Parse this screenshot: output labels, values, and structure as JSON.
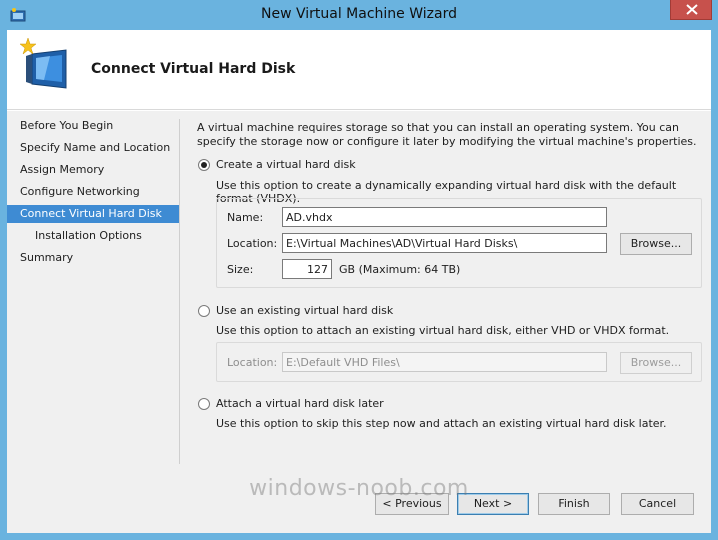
{
  "window": {
    "title": "New Virtual Machine Wizard"
  },
  "header": {
    "title": "Connect Virtual Hard Disk"
  },
  "nav": {
    "items": [
      {
        "label": "Before You Begin"
      },
      {
        "label": "Specify Name and Location"
      },
      {
        "label": "Assign Memory"
      },
      {
        "label": "Configure Networking"
      },
      {
        "label": "Connect Virtual Hard Disk",
        "active": true
      },
      {
        "label": "Installation Options",
        "sub": true
      },
      {
        "label": "Summary"
      }
    ]
  },
  "content": {
    "intro": "A virtual machine requires storage so that you can install an operating system. You can specify the storage now or configure it later by modifying the virtual machine's properties.",
    "option_create": {
      "label": "Create a virtual hard disk",
      "description": "Use this option to create a dynamically expanding virtual hard disk with the default format (VHDX).",
      "selected": true,
      "name_label": "Name:",
      "name_value": "AD.vhdx",
      "location_label": "Location:",
      "location_value": "E:\\Virtual Machines\\AD\\Virtual Hard Disks\\",
      "browse_label": "Browse...",
      "size_label": "Size:",
      "size_value": "127",
      "size_unit": "GB (Maximum: 64 TB)"
    },
    "option_existing": {
      "label": "Use an existing virtual hard disk",
      "description": "Use this option to attach an existing virtual hard disk, either VHD or VHDX format.",
      "selected": false,
      "location_label": "Location:",
      "location_value": "E:\\Default VHD Files\\",
      "browse_label": "Browse..."
    },
    "option_later": {
      "label": "Attach a virtual hard disk later",
      "description": "Use this option to skip this step now and attach an existing virtual hard disk later.",
      "selected": false
    }
  },
  "footer": {
    "previous_label": "< Previous",
    "next_label": "Next >",
    "finish_label": "Finish",
    "cancel_label": "Cancel"
  },
  "watermark": "windows-noob.com",
  "colors": {
    "titlebar": "#6ab3df",
    "nav_active": "#3e8bd3",
    "close_button": "#c7514c"
  },
  "icons": {
    "title": "hyperv-window-icon",
    "header": "new-vm-wizard-icon",
    "close": "close-icon"
  }
}
